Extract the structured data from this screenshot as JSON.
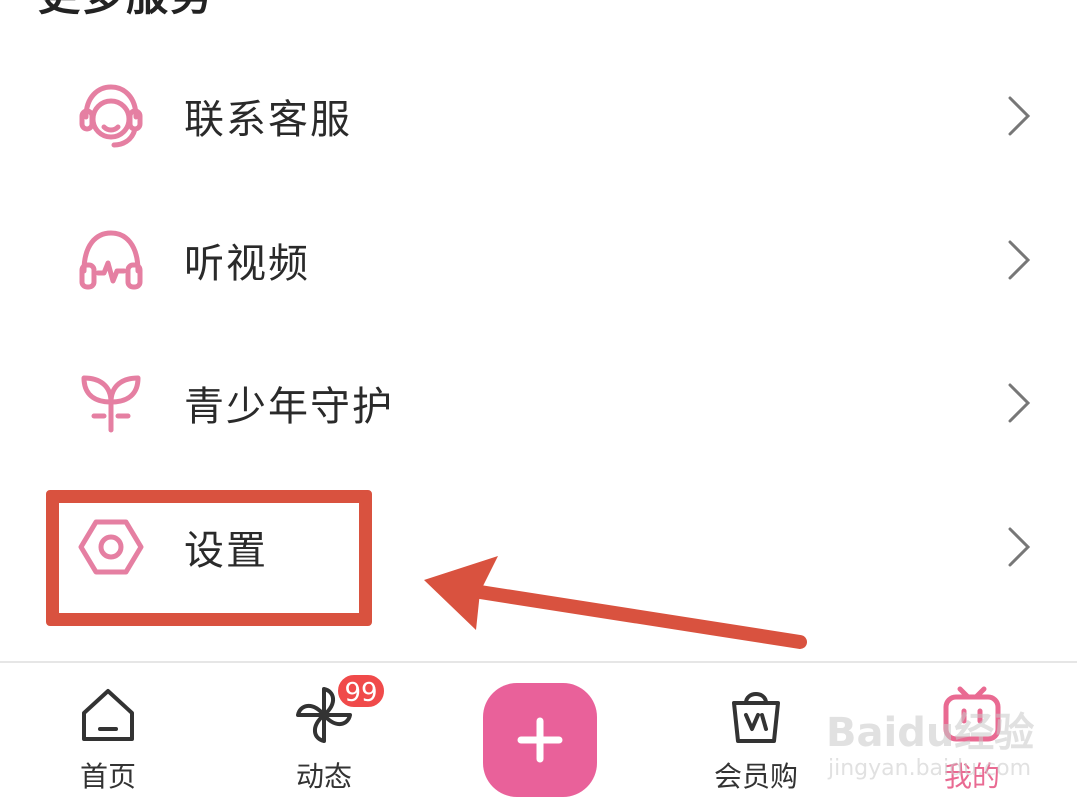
{
  "section": {
    "title": "更多服务"
  },
  "menu": {
    "items": [
      {
        "label": "联系客服",
        "icon": "headset-icon"
      },
      {
        "label": "听视频",
        "icon": "headphones-icon"
      },
      {
        "label": "青少年守护",
        "icon": "sprout-icon"
      },
      {
        "label": "设置",
        "icon": "gear-icon"
      }
    ]
  },
  "annotation": {
    "color": "#d9523f",
    "highlighted_item": "设置"
  },
  "tabbar": {
    "tabs": [
      {
        "label": "首页",
        "icon": "home-icon"
      },
      {
        "label": "动态",
        "icon": "pinwheel-icon",
        "badge": "99"
      },
      {
        "label": "",
        "icon": "plus-icon"
      },
      {
        "label": "会员购",
        "icon": "shopping-bag-icon"
      },
      {
        "label": "我的",
        "icon": "tv-icon",
        "active": true
      }
    ]
  },
  "watermark": {
    "logo": "Baidu经验",
    "url": "jingyan.baidu.com"
  },
  "colors": {
    "accent": "#e96a92",
    "icon_pink": "#e57fa2",
    "publish": "#e9619a",
    "badge": "#f04a4a"
  }
}
